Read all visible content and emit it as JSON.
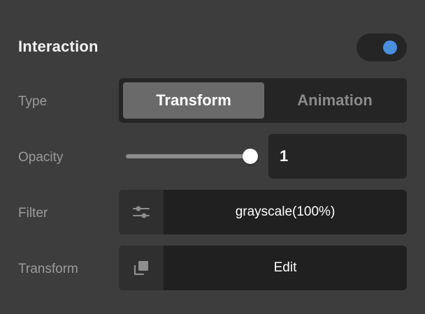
{
  "header": {
    "title": "Interaction",
    "toggle_on": true,
    "toggle_color": "#4a8ede"
  },
  "rows": {
    "type": {
      "label": "Type",
      "options": [
        "Transform",
        "Animation"
      ],
      "selected": "Transform"
    },
    "opacity": {
      "label": "Opacity",
      "value": "1",
      "slider_value": 1
    },
    "filter": {
      "label": "Filter",
      "icon": "sliders-icon",
      "value": "grayscale(100%)"
    },
    "transform": {
      "label": "Transform",
      "icon": "transform-copy-icon",
      "value": "Edit"
    }
  }
}
